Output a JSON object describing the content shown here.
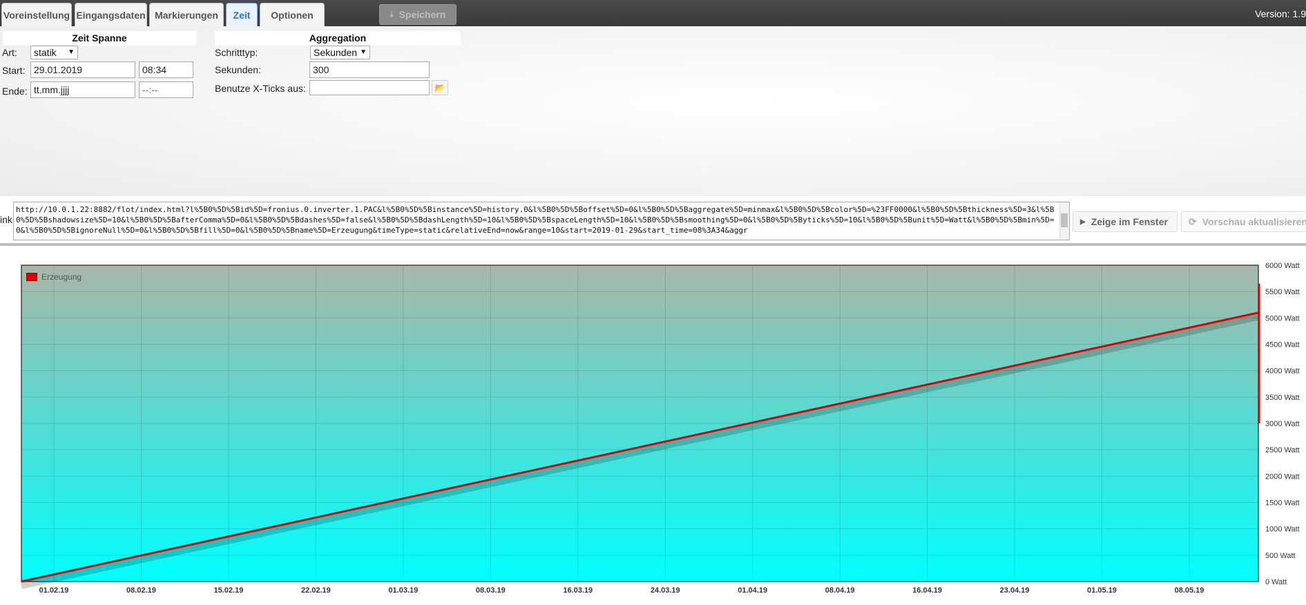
{
  "tabs": [
    {
      "label": "Voreinstellung",
      "active": false
    },
    {
      "label": "Eingangsdaten",
      "active": false
    },
    {
      "label": "Markierungen",
      "active": false
    },
    {
      "label": "Zeit",
      "active": true
    },
    {
      "label": "Optionen",
      "active": false
    }
  ],
  "toolbar": {
    "save_label": "Speichern",
    "save_icon": "download-icon",
    "version": "Version: 1.9"
  },
  "zeitspanne": {
    "title": "Zeit Spanne",
    "art_label": "Art:",
    "art_value": "statik",
    "start_label": "Start:",
    "start_date": "29.01.2019",
    "start_time": "08:34",
    "end_label": "Ende:",
    "end_date_placeholder": "tt.mm.jjjj",
    "end_time_placeholder": "--:--"
  },
  "aggregation": {
    "title": "Aggregation",
    "schritttyp_label": "Schritttyp:",
    "schritttyp_value": "Sekunden",
    "sekunden_label": "Sekunden:",
    "sekunden_value": "300",
    "xticks_label": "Benutze X-Ticks aus:",
    "xticks_value": ""
  },
  "link": {
    "label": "ink",
    "url": "http://10.0.1.22:8882/flot/index.html?l%5B0%5D%5Bid%5D=fronius.0.inverter.1.PAC&l%5B0%5D%5Binstance%5D=history.0&l%5B0%5D%5Boffset%5D=0&l%5B0%5D%5Baggregate%5D=minmax&l%5B0%5D%5Bcolor%5D=%23FF0000&l%5B0%5D%5Bthickness%5D=3&l%5B0%5D%5Bshadowsize%5D=10&l%5B0%5D%5BafterComma%5D=0&l%5B0%5D%5Bdashes%5D=false&l%5B0%5D%5BdashLength%5D=10&l%5B0%5D%5BspaceLength%5D=10&l%5B0%5D%5Bsmoothing%5D=0&l%5B0%5D%5Byticks%5D=10&l%5B0%5D%5Bunit%5D=Watt&l%5B0%5D%5Bmin%5D=0&l%5B0%5D%5BignoreNull%5D=0&l%5B0%5D%5Bfill%5D=0&l%5B0%5D%5Bname%5D=Erzeugung&timeType=static&relativeEnd=now&range=10&start=2019-01-29&start_time=08%3A34&aggr"
  },
  "buttons": {
    "show_window": "Zeige im Fenster",
    "refresh_preview": "Vorschau aktualisieren"
  },
  "colors": {
    "series": "#e00000",
    "bg_top": "#a8b8a8",
    "bg_bottom": "#00ffff"
  },
  "chart_data": {
    "type": "line",
    "title": "",
    "xlabel": "",
    "ylabel": "",
    "x_tick_labels": [
      "01.02.19",
      "08.02.19",
      "15.02.19",
      "22.02.19",
      "01.03.19",
      "08.03.19",
      "16.03.19",
      "24.03.19",
      "01.04.19",
      "08.04.19",
      "16.04.19",
      "23.04.19",
      "01.05.19",
      "08.05.19"
    ],
    "y_tick_labels": [
      "0 Watt",
      "500 Watt",
      "1000 Watt",
      "1500 Watt",
      "2000 Watt",
      "2500 Watt",
      "3000 Watt",
      "3500 Watt",
      "4000 Watt",
      "4500 Watt",
      "5000 Watt",
      "5500 Watt",
      "6000 Watt"
    ],
    "ylim": [
      0,
      6000
    ],
    "unit": "Watt",
    "series": [
      {
        "name": "Erzeugung",
        "color": "#e00000",
        "points": [
          [
            0,
            0
          ],
          [
            1,
            5100
          ]
        ],
        "spike": [
          3000,
          5650
        ]
      }
    ],
    "legend": "top-left",
    "grid": true
  }
}
